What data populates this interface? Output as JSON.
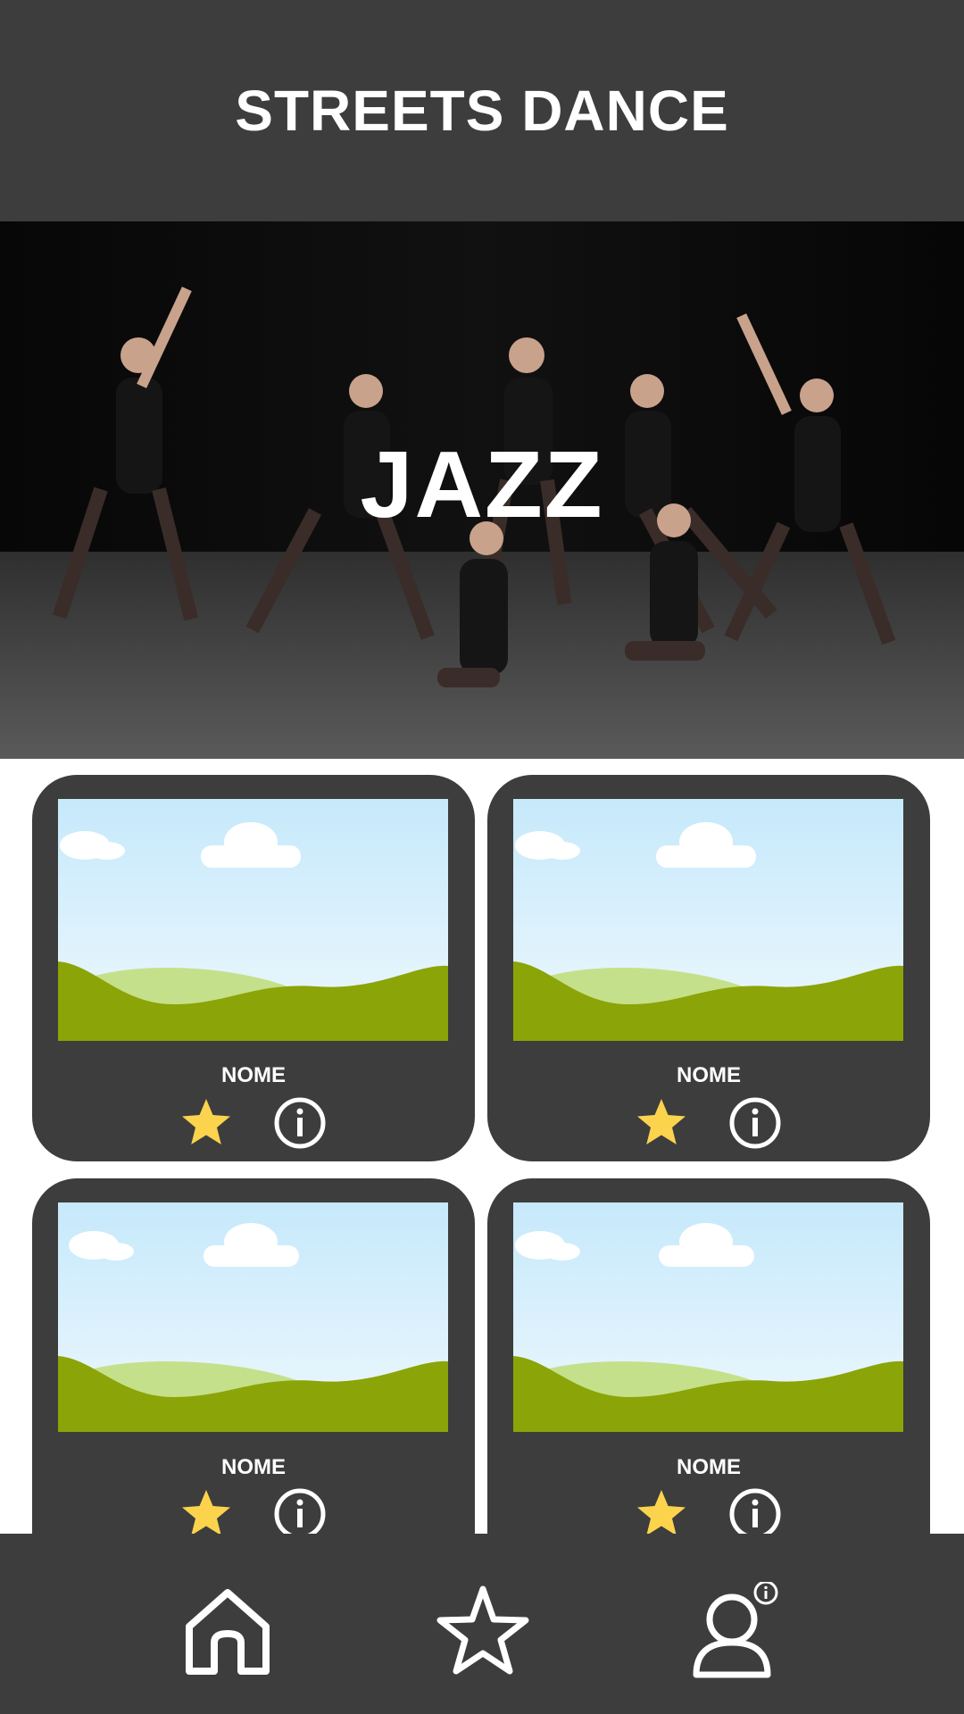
{
  "app": {
    "title": "STREETS DANCE"
  },
  "hero": {
    "title": "JAZZ"
  },
  "cards": [
    {
      "name": "NOME"
    },
    {
      "name": "NOME"
    },
    {
      "name": "NOME"
    },
    {
      "name": "NOME"
    }
  ],
  "icons": {
    "favorite": "star-icon",
    "info": "info-icon",
    "home": "home-icon",
    "favorites_nav": "star-outline-icon",
    "profile": "user-info-icon"
  },
  "colors": {
    "bar": "#3d3d3d",
    "star": "#fcd34d",
    "white": "#ffffff"
  }
}
